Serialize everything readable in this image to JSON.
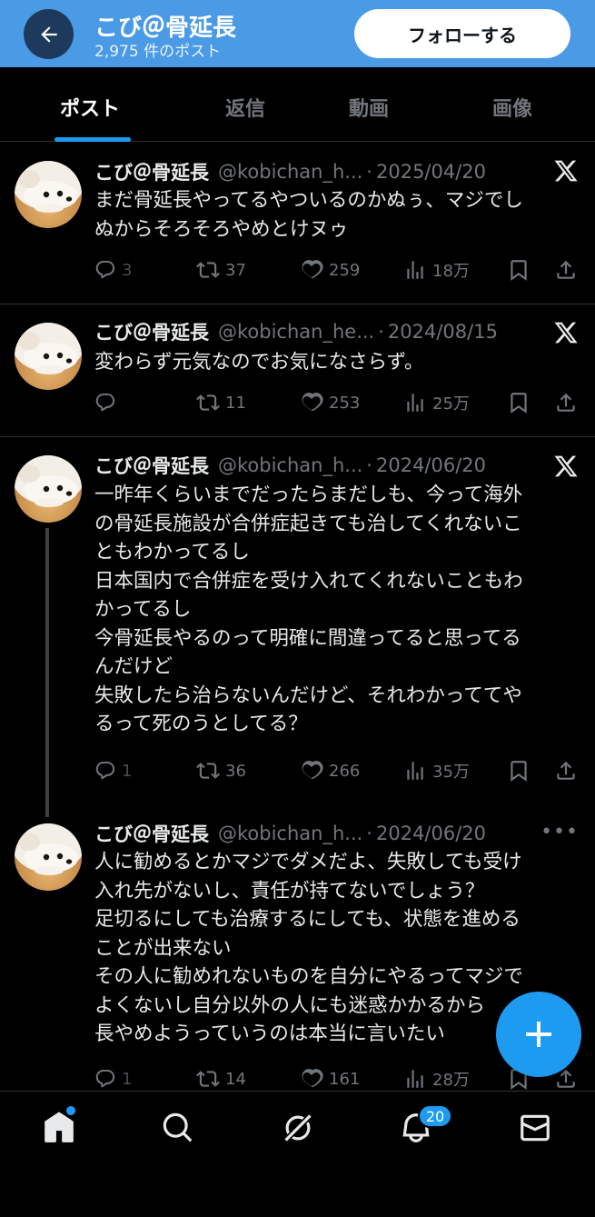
{
  "header": {
    "name": "こび＠骨延長",
    "post_count": "2,975 件のポスト",
    "follow_label": "フォローする"
  },
  "tabs": [
    {
      "label": "ポスト",
      "active": true
    },
    {
      "label": "返信",
      "active": false
    },
    {
      "label": "動画",
      "active": false
    },
    {
      "label": "画像",
      "active": false
    }
  ],
  "posts": [
    {
      "name": "こび＠骨延長",
      "handle": "@kobichan_h...",
      "date": "2025/04/20",
      "text": "まだ骨延長やってるやついるのかぬぅ、マジでし\nぬからそろそろやめとけヌゥ",
      "replies": "3",
      "reposts": "37",
      "likes": "259",
      "views": "18万"
    },
    {
      "name": "こび＠骨延長",
      "handle": "@kobichan_he...",
      "date": "2024/08/15",
      "text": "変わらず元気なのでお気になさらず。",
      "replies": "",
      "reposts": "11",
      "likes": "253",
      "views": "25万"
    },
    {
      "name": "こび＠骨延長",
      "handle": "@kobichan_h...",
      "date": "2024/06/20",
      "text": "一昨年くらいまでだったらまだしも、今って海外\nの骨延長施設が合併症起きても治してくれないこ\nともわかってるし\n日本国内で合併症を受け入れてくれないこともわ\nかってるし\n今骨延長やるのって明確に間違ってると思ってる\nんだけど\n失敗したら治らないんだけど、それわかっててや\nるって死のうとしてる？",
      "replies": "1",
      "reposts": "36",
      "likes": "266",
      "views": "35万"
    },
    {
      "name": "こび＠骨延長",
      "handle": "@kobichan_h...",
      "date": "2024/06/20",
      "text": "人に勧めるとかマジでダメだよ、失敗しても受け\n入れ先がないし、責任が持てないでしょう？\n足切るにしても治療するにしても、状態を進める\nことが出来ない\nその人に勧めれないものを自分にやるってマジで\nよくないし自分以外の人にも迷惑かかるから\n長やめようっていうのは本当に言いたい",
      "replies": "1",
      "reposts": "14",
      "likes": "161",
      "views": "28万"
    }
  ],
  "nav": {
    "notification_badge": "20"
  },
  "colors": {
    "header_bg": "#4a9ae6",
    "accent": "#1d9bf0",
    "background": "#000000",
    "muted": "#71767b"
  }
}
